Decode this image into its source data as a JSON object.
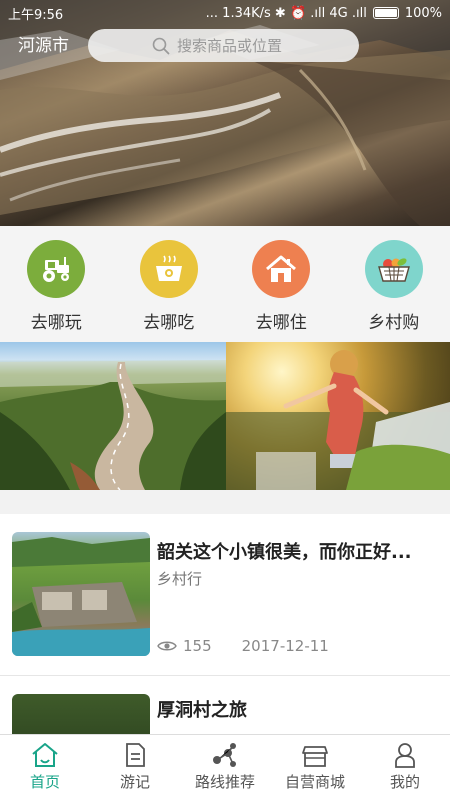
{
  "status_bar": {
    "time": "上午9:56",
    "indicators": "... 1.34K/s  ✱ ⏰ .ıll 4G .ıll",
    "battery": "100%"
  },
  "header": {
    "city": "河源市",
    "search_placeholder": "搜索商品或位置"
  },
  "categories": [
    {
      "label": "去哪玩",
      "icon": "tractor-icon",
      "color": "#7cad3c"
    },
    {
      "label": "去哪吃",
      "icon": "cooking-pot-icon",
      "color": "#e9c43c"
    },
    {
      "label": "去哪住",
      "icon": "house-icon",
      "color": "#ee8050"
    },
    {
      "label": "乡村购",
      "icon": "fruit-basket-icon",
      "color": "#7fd5cc"
    }
  ],
  "articles": [
    {
      "title": "韶关这个小镇很美，而你正好...",
      "category": "乡村行",
      "views": "155",
      "date": "2017-12-11"
    },
    {
      "title": "厚洞村之旅"
    }
  ],
  "tab_bar": [
    {
      "label": "首页",
      "icon": "home-icon",
      "active": true
    },
    {
      "label": "游记",
      "icon": "notes-icon",
      "active": false
    },
    {
      "label": "路线推荐",
      "icon": "route-icon",
      "active": false
    },
    {
      "label": "自营商城",
      "icon": "shop-icon",
      "active": false
    },
    {
      "label": "我的",
      "icon": "user-icon",
      "active": false
    }
  ],
  "colors": {
    "accent": "#19a489"
  }
}
